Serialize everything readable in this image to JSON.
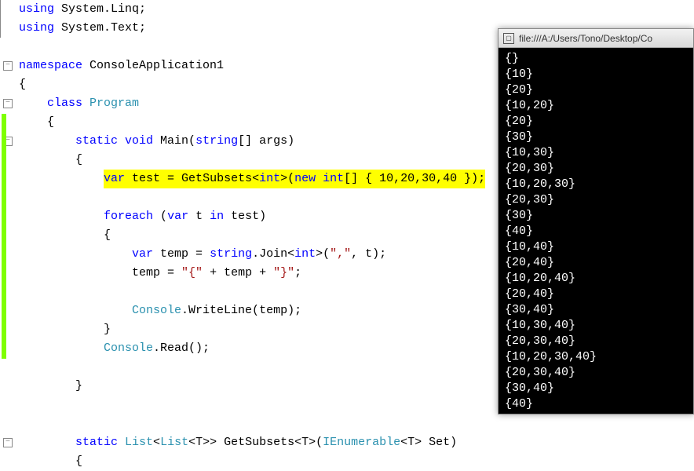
{
  "editor": {
    "lines": [
      {
        "indent": "",
        "tokens": [
          {
            "t": "using ",
            "c": "kw"
          },
          {
            "t": "System.Linq;",
            "c": "ident"
          }
        ],
        "fold": null,
        "bar": true
      },
      {
        "indent": "",
        "tokens": [
          {
            "t": "using ",
            "c": "kw"
          },
          {
            "t": "System.Text;",
            "c": "ident"
          }
        ],
        "fold": null,
        "bar": true
      },
      {
        "indent": "",
        "tokens": [],
        "fold": null
      },
      {
        "indent": "",
        "tokens": [
          {
            "t": "namespace ",
            "c": "kw"
          },
          {
            "t": "ConsoleApplication1",
            "c": "ident"
          }
        ],
        "fold": "minus"
      },
      {
        "indent": "",
        "tokens": [
          {
            "t": "{",
            "c": "ident"
          }
        ],
        "fold": null
      },
      {
        "indent": "    ",
        "tokens": [
          {
            "t": "class ",
            "c": "kw"
          },
          {
            "t": "Program",
            "c": "type"
          }
        ],
        "fold": "minus"
      },
      {
        "indent": "    ",
        "tokens": [
          {
            "t": "{",
            "c": "ident"
          }
        ],
        "fold": null
      },
      {
        "indent": "        ",
        "tokens": [
          {
            "t": "static ",
            "c": "kw"
          },
          {
            "t": "void ",
            "c": "kw"
          },
          {
            "t": "Main(",
            "c": "ident"
          },
          {
            "t": "string",
            "c": "kw"
          },
          {
            "t": "[] args)",
            "c": "ident"
          }
        ],
        "fold": "minus"
      },
      {
        "indent": "        ",
        "tokens": [
          {
            "t": "{",
            "c": "ident"
          }
        ],
        "fold": null
      },
      {
        "indent": "            ",
        "tokens": [
          {
            "t": "var",
            "c": "kw",
            "hl": true
          },
          {
            "t": " test = GetSubsets<",
            "c": "ident",
            "hl": true
          },
          {
            "t": "int",
            "c": "kw",
            "hl": true
          },
          {
            "t": ">(",
            "c": "ident",
            "hl": true
          },
          {
            "t": "new",
            "c": "kw",
            "hl": true
          },
          {
            "t": " ",
            "c": "ident",
            "hl": true
          },
          {
            "t": "int",
            "c": "kw",
            "hl": true
          },
          {
            "t": "[] { 10,20,30,40 });",
            "c": "ident",
            "hl": true
          }
        ],
        "fold": null
      },
      {
        "indent": "",
        "tokens": [],
        "fold": null
      },
      {
        "indent": "            ",
        "tokens": [
          {
            "t": "foreach ",
            "c": "kw"
          },
          {
            "t": "(",
            "c": "ident"
          },
          {
            "t": "var ",
            "c": "kw"
          },
          {
            "t": "t ",
            "c": "ident"
          },
          {
            "t": "in ",
            "c": "kw"
          },
          {
            "t": "test)",
            "c": "ident"
          }
        ],
        "fold": null
      },
      {
        "indent": "            ",
        "tokens": [
          {
            "t": "{",
            "c": "ident"
          }
        ],
        "fold": null
      },
      {
        "indent": "                ",
        "tokens": [
          {
            "t": "var ",
            "c": "kw"
          },
          {
            "t": "temp = ",
            "c": "ident"
          },
          {
            "t": "string",
            "c": "kw"
          },
          {
            "t": ".Join<",
            "c": "ident"
          },
          {
            "t": "int",
            "c": "kw"
          },
          {
            "t": ">(",
            "c": "ident"
          },
          {
            "t": "\",\"",
            "c": "str"
          },
          {
            "t": ", t);",
            "c": "ident"
          }
        ],
        "fold": null
      },
      {
        "indent": "                ",
        "tokens": [
          {
            "t": "temp = ",
            "c": "ident"
          },
          {
            "t": "\"{\"",
            "c": "str"
          },
          {
            "t": " + temp + ",
            "c": "ident"
          },
          {
            "t": "\"}\"",
            "c": "str"
          },
          {
            "t": ";",
            "c": "ident"
          }
        ],
        "fold": null
      },
      {
        "indent": "",
        "tokens": [],
        "fold": null
      },
      {
        "indent": "                ",
        "tokens": [
          {
            "t": "Console",
            "c": "type"
          },
          {
            "t": ".WriteLine(temp);",
            "c": "ident"
          }
        ],
        "fold": null
      },
      {
        "indent": "            ",
        "tokens": [
          {
            "t": "}",
            "c": "ident"
          }
        ],
        "fold": null
      },
      {
        "indent": "            ",
        "tokens": [
          {
            "t": "Console",
            "c": "type"
          },
          {
            "t": ".Read();",
            "c": "ident"
          }
        ],
        "fold": null
      },
      {
        "indent": "",
        "tokens": [],
        "fold": null
      },
      {
        "indent": "        ",
        "tokens": [
          {
            "t": "}",
            "c": "ident"
          }
        ],
        "fold": null
      },
      {
        "indent": "",
        "tokens": [],
        "fold": null
      },
      {
        "indent": "",
        "tokens": [],
        "fold": null
      },
      {
        "indent": "        ",
        "tokens": [
          {
            "t": "static ",
            "c": "kw"
          },
          {
            "t": "List",
            "c": "type"
          },
          {
            "t": "<",
            "c": "ident"
          },
          {
            "t": "List",
            "c": "type"
          },
          {
            "t": "<T>> GetSubsets<T>(",
            "c": "ident"
          },
          {
            "t": "IEnumerable",
            "c": "type"
          },
          {
            "t": "<T> Set)",
            "c": "ident"
          }
        ],
        "fold": "minus"
      },
      {
        "indent": "        ",
        "tokens": [
          {
            "t": "{",
            "c": "ident"
          }
        ],
        "fold": null
      }
    ]
  },
  "console": {
    "title": "file:///A:/Users/Tono/Desktop/Co",
    "output": [
      "{}",
      "{10}",
      "{20}",
      "{10,20}",
      "{20}",
      "{30}",
      "{10,30}",
      "{20,30}",
      "{10,20,30}",
      "{20,30}",
      "{30}",
      "{40}",
      "{10,40}",
      "{20,40}",
      "{10,20,40}",
      "{20,40}",
      "{30,40}",
      "{10,30,40}",
      "{20,30,40}",
      "{10,20,30,40}",
      "{20,30,40}",
      "{30,40}",
      "{40}"
    ]
  }
}
